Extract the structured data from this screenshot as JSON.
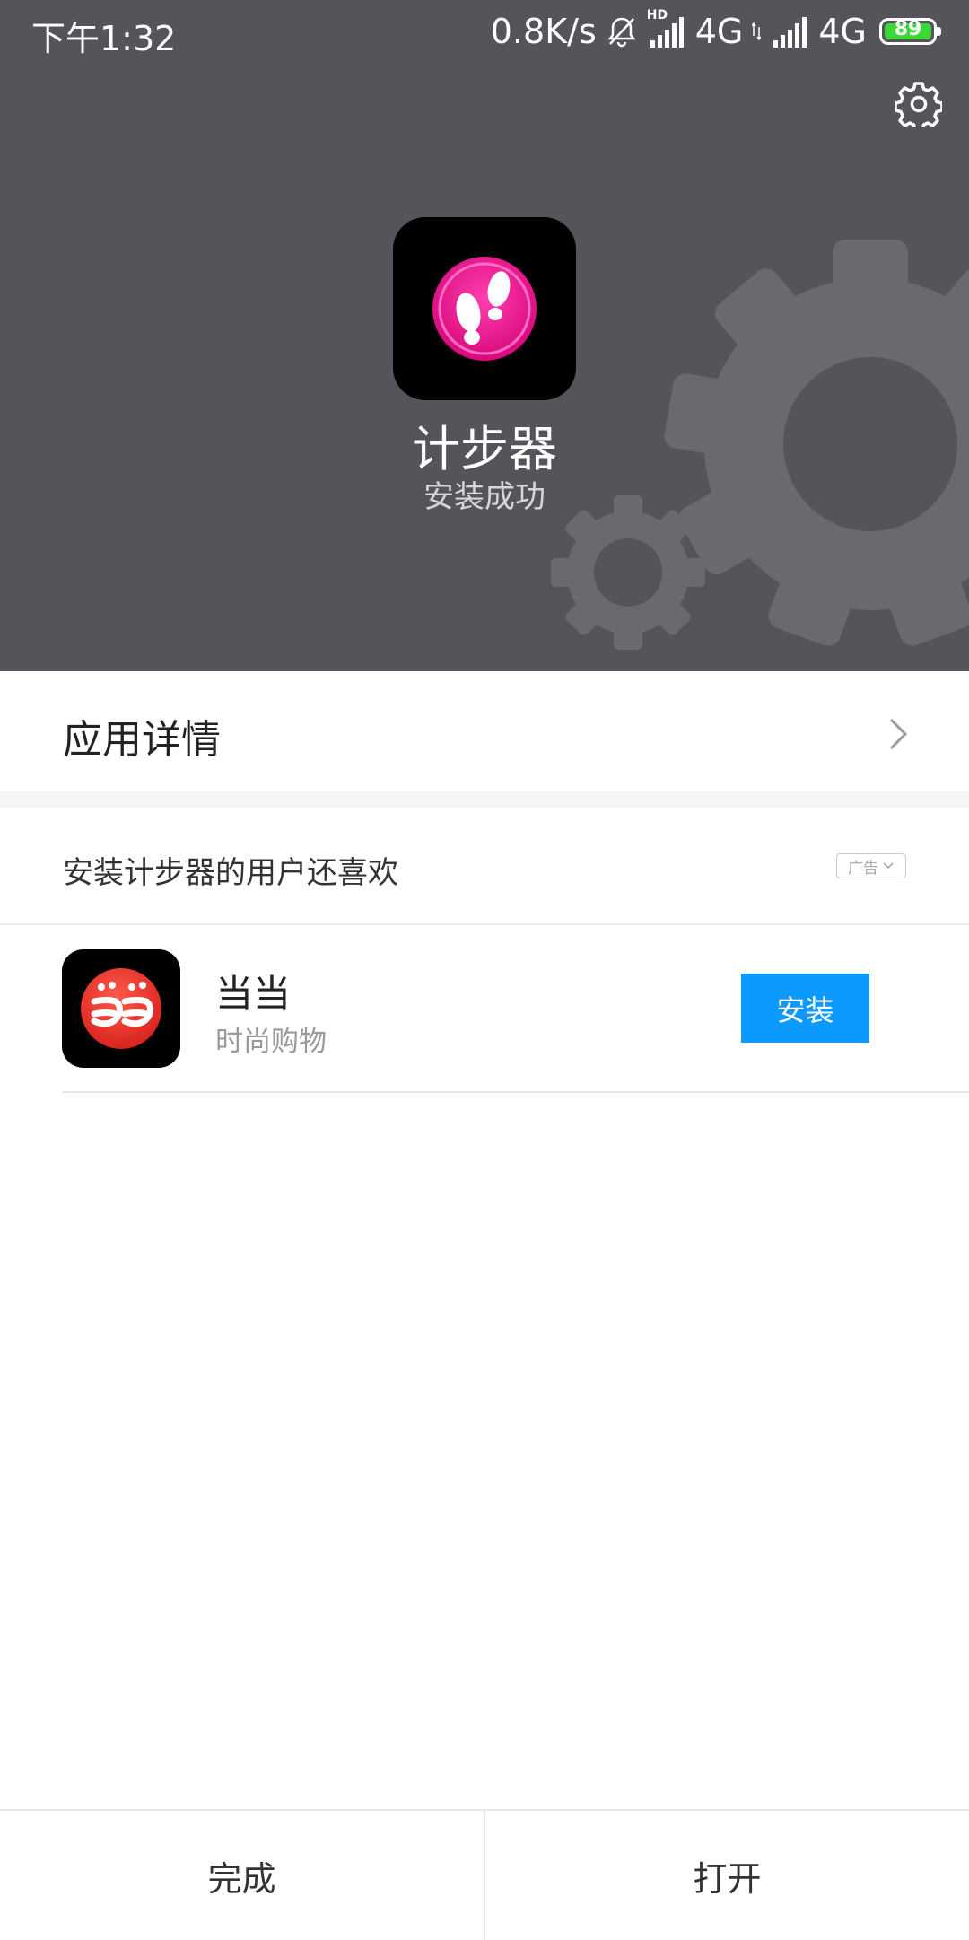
{
  "status_bar": {
    "time": "下午1:32",
    "network_speed": "0.8K/s",
    "hd_label": "HD",
    "network_1": "4G",
    "network_2": "4G",
    "battery_level": "89",
    "icons": [
      "mute-bell-icon",
      "signal-icon",
      "signal-icon",
      "battery-icon"
    ]
  },
  "header": {
    "app_name": "计步器",
    "status": "安装成功",
    "settings_icon": "gear-icon",
    "app_icon": "footprint-icon"
  },
  "details": {
    "label": "应用详情",
    "chevron_icon": "chevron-right-icon"
  },
  "recommend": {
    "title": "安装计步器的用户还喜欢",
    "ad_label": "广告",
    "items": [
      {
        "name": "当当",
        "desc": "时尚购物",
        "button_label": "安装",
        "icon": "dangdang-logo"
      }
    ]
  },
  "bottom": {
    "done_label": "完成",
    "open_label": "打开"
  },
  "colors": {
    "header_bg": "#55545b",
    "accent_blue": "#0d9aff",
    "app_icon_magenta": "#e8148c",
    "dangdang_red": "#e8382e",
    "battery_green": "#3dd63a"
  }
}
